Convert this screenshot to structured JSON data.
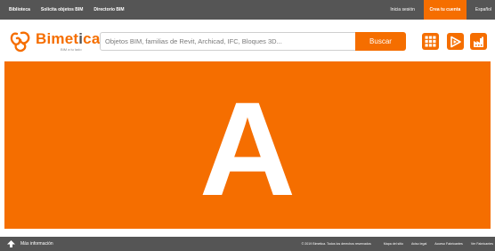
{
  "topbar": {
    "links": [
      "Biblioteca",
      "Solicita objetos BIM",
      "Directorio BIM"
    ],
    "login": "Inicia sesión",
    "create_account": "Crea tu cuenta",
    "language": "Español"
  },
  "header": {
    "logo": {
      "name_main": "Bimet",
      "name_accent": "i",
      "name_end": "ca",
      "tagline": "BIM a tu lado"
    },
    "search": {
      "placeholder": "Objetos BIM, familias de Revit, Archicad, IFC, Bloques 3D...",
      "value": "",
      "button": "Buscar"
    },
    "icons": [
      "grid-icon",
      "play-icon",
      "factory-icon"
    ]
  },
  "hero": {
    "letter": "A"
  },
  "footer": {
    "more_info": "Más información",
    "copyright": "© 2019 Bimetica. Todos los derechos reservados",
    "links": [
      "Mapa del sitio",
      "Aviso legal",
      "Acceso Fabricantes",
      "Ver Fabricantes"
    ]
  },
  "colors": {
    "accent": "#f56e00",
    "bar": "#555555",
    "background": "#ffffff"
  }
}
